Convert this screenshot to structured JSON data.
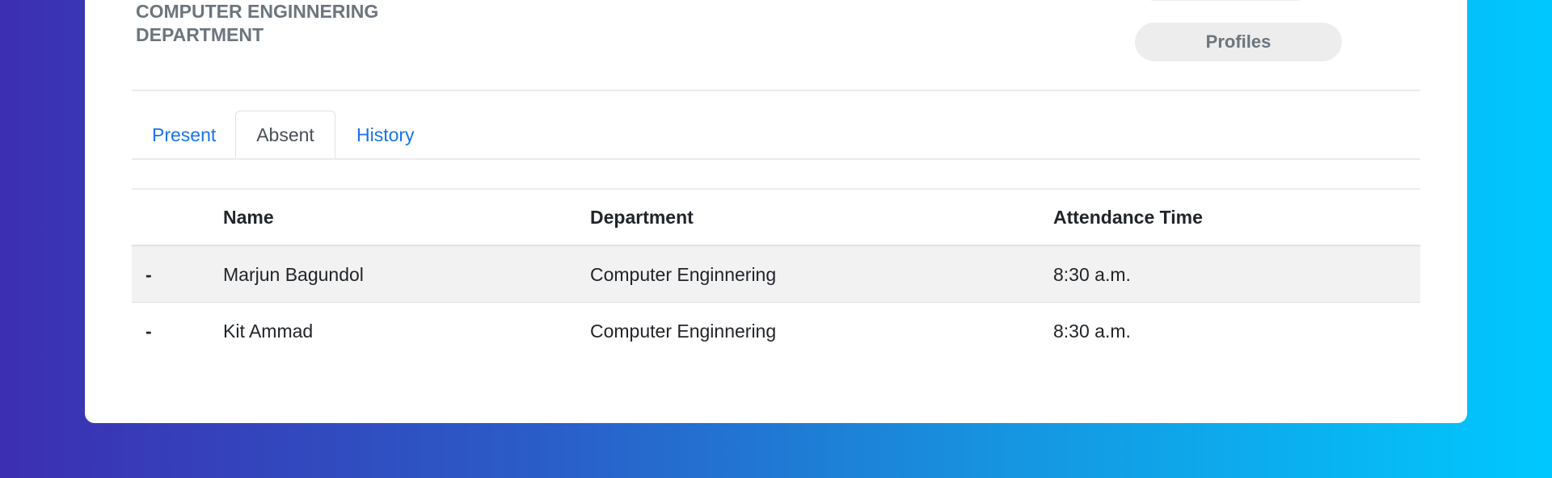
{
  "department_title": "COMPUTER ENGINNERING DEPARTMENT",
  "profiles_button": "Profiles",
  "tabs": [
    {
      "label": "Present",
      "active": false
    },
    {
      "label": "Absent",
      "active": true
    },
    {
      "label": "History",
      "active": false
    }
  ],
  "table": {
    "headers": [
      "",
      "Name",
      "Department",
      "Attendance Time"
    ],
    "rows": [
      {
        "marker": "-",
        "name": "Marjun Bagundol",
        "department": "Computer Enginnering",
        "time": "8:30 a.m."
      },
      {
        "marker": "-",
        "name": "Kit Ammad",
        "department": "Computer Enginnering",
        "time": "8:30 a.m."
      }
    ]
  },
  "colors": {
    "link": "#1a73e8",
    "gradient_start": "#3c2fb1",
    "gradient_end": "#00c8fe"
  }
}
